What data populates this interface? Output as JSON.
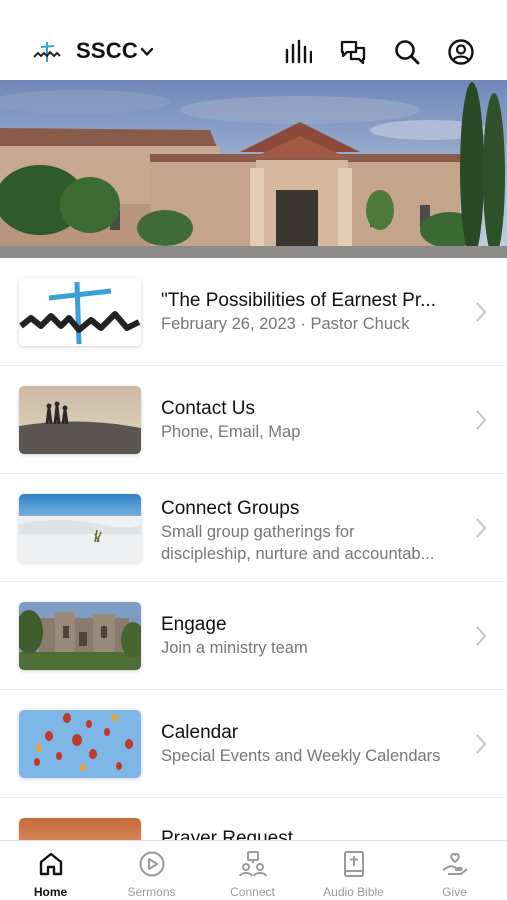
{
  "header": {
    "org_name": "SSCC",
    "icons": [
      "logo-icon",
      "chevron-down-icon",
      "audio-bars-icon",
      "messages-icon",
      "search-icon",
      "profile-icon"
    ]
  },
  "hero": {
    "icon": "church-building-photo"
  },
  "list": {
    "items": [
      {
        "title": "\"The Possibilities of Earnest Pr...",
        "subtitle": "February 26, 2023 · Pastor Chuck",
        "subtitle2": "",
        "thumb": "church-logo"
      },
      {
        "title": "Contact Us",
        "subtitle": "Phone, Email, Map",
        "subtitle2": "",
        "thumb": "people-on-dune"
      },
      {
        "title": "Connect Groups",
        "subtitle": "Small group gatherings for",
        "subtitle2": "discipleship, nurture and accountab...",
        "thumb": "white-sands"
      },
      {
        "title": "Engage",
        "subtitle": "Join a ministry team",
        "subtitle2": "",
        "thumb": "mission-ruins"
      },
      {
        "title": "Calendar",
        "subtitle": "Special Events and Weekly Calendars",
        "subtitle2": "",
        "thumb": "hot-air-balloons"
      },
      {
        "title": "Prayer Request",
        "subtitle": "",
        "subtitle2": "",
        "thumb": "sunset"
      }
    ]
  },
  "tabbar": {
    "tabs": [
      {
        "label": "Home",
        "icon": "home-icon",
        "active": true
      },
      {
        "label": "Sermons",
        "icon": "play-icon",
        "active": false
      },
      {
        "label": "Connect",
        "icon": "people-icon",
        "active": false
      },
      {
        "label": "Audio Bible",
        "icon": "bible-icon",
        "active": false
      },
      {
        "label": "Give",
        "icon": "give-icon",
        "active": false
      }
    ]
  },
  "colors": {
    "accent": "#111111",
    "inactive": "#9a9a9a",
    "subtitle": "#777777",
    "logo_blue": "#3aa0d8"
  }
}
